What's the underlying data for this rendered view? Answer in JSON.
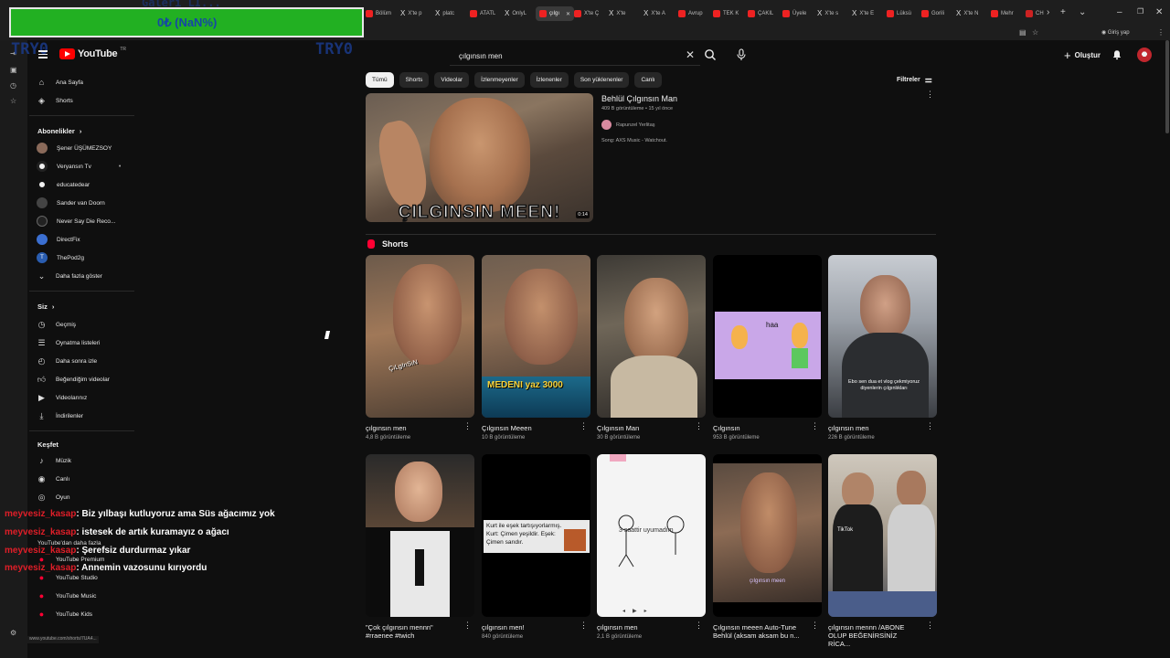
{
  "browser": {
    "tabs": [
      "Bölüm",
      "X'te p",
      "platc",
      "ATATL",
      "OnlyL",
      "çılgı",
      "X'te Ç",
      "X'te",
      "X'te A",
      "Avrup",
      "TEK K",
      "ÇAKIL",
      "Üyele",
      "X'te s",
      "X'te E",
      "Lüksü",
      "Gorili",
      "X'te N",
      "Mehr",
      "CH"
    ],
    "sign_in": "Giriş yap",
    "status_url": "www.youtube.com/shorts/7UA4..."
  },
  "overlay": {
    "counter": "0₺ (NaN%)",
    "ghost_left": "TRY0",
    "ghost_right": "TRY0",
    "ghost_top": "Galeri Lİ..."
  },
  "header": {
    "logo_word": "YouTube",
    "logo_tm": "TR",
    "search_value": "çılgınsın men",
    "create_label": "Oluştur"
  },
  "sidebar": {
    "nav": [
      {
        "label": "Ana Sayfa",
        "icon": "home-icon"
      },
      {
        "label": "Shorts",
        "icon": "shorts-icon"
      }
    ],
    "subs_title": "Abonelikler",
    "subscriptions": [
      {
        "label": "Şener ÜŞÜMEZSOY",
        "color": "#8a6a5a"
      },
      {
        "label": "Veryansın Tv",
        "color": "#f1f1f1",
        "live": "•"
      },
      {
        "label": "educatedear",
        "color": "#f1f1f1"
      },
      {
        "label": "Sander van Doorn",
        "color": "#333333"
      },
      {
        "label": "Never Say Die Reco...",
        "color": "#222222"
      },
      {
        "label": "DirectFix",
        "color": "#3b6fd1"
      },
      {
        "label": "ThePod2g",
        "color": "#2a5db0",
        "letter": "T"
      }
    ],
    "more_label": "Daha fazla göster",
    "you_title": "Siz",
    "you_items": [
      {
        "label": "Geçmiş",
        "icon": "history-icon"
      },
      {
        "label": "Oynatma listeleri",
        "icon": "playlist-icon"
      },
      {
        "label": "Daha sonra izle",
        "icon": "watch-later-icon"
      },
      {
        "label": "Beğendiğim videolar",
        "icon": "like-icon"
      },
      {
        "label": "Videolarınız",
        "icon": "your-videos-icon"
      },
      {
        "label": "İndirilenler",
        "icon": "download-icon"
      }
    ],
    "explore_title": "Keşfet",
    "explore_items": [
      {
        "label": "Müzik",
        "icon": "music-icon"
      },
      {
        "label": "Canlı",
        "icon": "live-icon"
      },
      {
        "label": "Oyun",
        "icon": "gaming-icon"
      }
    ],
    "more_from": "YouTube'dan daha fazla",
    "yt_apps": [
      "YouTube Premium",
      "YouTube Studio",
      "YouTube Music",
      "YouTube Kids"
    ]
  },
  "chips": [
    "Tümü",
    "Shorts",
    "Videolar",
    "İzlenmeyenler",
    "İzlenenler",
    "Son yüklenenler",
    "Canlı"
  ],
  "filters_label": "Filtreler",
  "top_result": {
    "title": "Behlül Çılgınsın Man",
    "meta": "409 B görüntüleme • 15 yıl önce",
    "channel": "Rapunzel Yerlitaş",
    "description": "Song: AXS Music - Watchout.",
    "thumb_caption": "ÇILGINSIN MEEN!",
    "duration": "0:14"
  },
  "shorts_section": {
    "title": "Shorts",
    "row1": [
      {
        "title": "çılgınsın men",
        "views": "4,8 B görüntüleme",
        "overlay": "ÇıLgInSıN"
      },
      {
        "title": "Çılgınsın Meeen",
        "views": "10 B görüntüleme",
        "overlay": "MEDENI yaz 3000"
      },
      {
        "title": "Çılgınsın Man",
        "views": "30 B görüntüleme",
        "overlay": ""
      },
      {
        "title": "Çılgınsın",
        "views": "953 B görüntüleme",
        "overlay": "haa"
      },
      {
        "title": "çılgınsın men",
        "views": "226 B görüntüleme",
        "overlay": "Ebo sen dua et vlog çekmiyoruz diyenlerin çılgınlıkları"
      }
    ],
    "row2": [
      {
        "title": "\"Çok çılgınsın mennn\" #rraenee #twich",
        "views": ""
      },
      {
        "title": "çılgınsın men!",
        "views": "840 görüntüleme",
        "overlay": "Kurt ile eşek tartışıyorlarmış. Kurt: Çimen yeşildir. Eşek: Çimen sarıdır."
      },
      {
        "title": "çılgınsın men",
        "views": "2,1 B görüntüleme",
        "overlay": "3 saattir uyumadım"
      },
      {
        "title": "Çılgınsın meeen Auto-Tune Behlül (aksam aksam bu n...",
        "views": "",
        "overlay": "çılgınsın meen"
      },
      {
        "title": "çılgınsın mennn /ABONE OLUP BEĞENİRSİNİZ RİCA...",
        "views": "",
        "overlay": "TikTok"
      }
    ]
  },
  "chat": [
    {
      "user": "meyvesiz_kasap",
      "message": ": Biz yılbaşı kutluyoruz ama Süs ağacımız yok"
    },
    {
      "user": "meyvesiz_kasap",
      "message": ": istesek de artık kuramayız o ağacı"
    },
    {
      "user": "meyvesiz_kasap",
      "message": ": Şerefsiz durdurmaz yıkar"
    },
    {
      "user": "meyvesiz_kasap",
      "message": ": Annemin vazosunu kırıyordu"
    }
  ],
  "colors": {
    "brand_red": "#ff0000",
    "overlay_green": "#22b022",
    "chat_user": "#e01e28"
  }
}
